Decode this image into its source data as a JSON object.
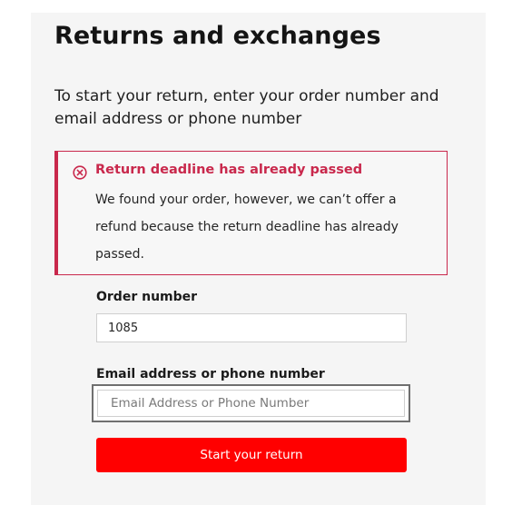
{
  "page": {
    "title": "Returns and exchanges",
    "intro": "To start your return, enter your order number and email address or phone number"
  },
  "alert": {
    "icon": "error-circle-x-icon",
    "title": "Return deadline has already passed",
    "message": "We found your order, however, we can’t offer a refund because the return deadline has already passed.",
    "color": "#c9284c"
  },
  "form": {
    "order_number": {
      "label": "Order number",
      "value": "1085"
    },
    "contact": {
      "label": "Email address or phone number",
      "value": "",
      "placeholder": "Email Address or Phone Number"
    },
    "submit_label": "Start your return"
  },
  "colors": {
    "primary_button": "#ff0000",
    "panel_background": "#f5f5f5"
  }
}
